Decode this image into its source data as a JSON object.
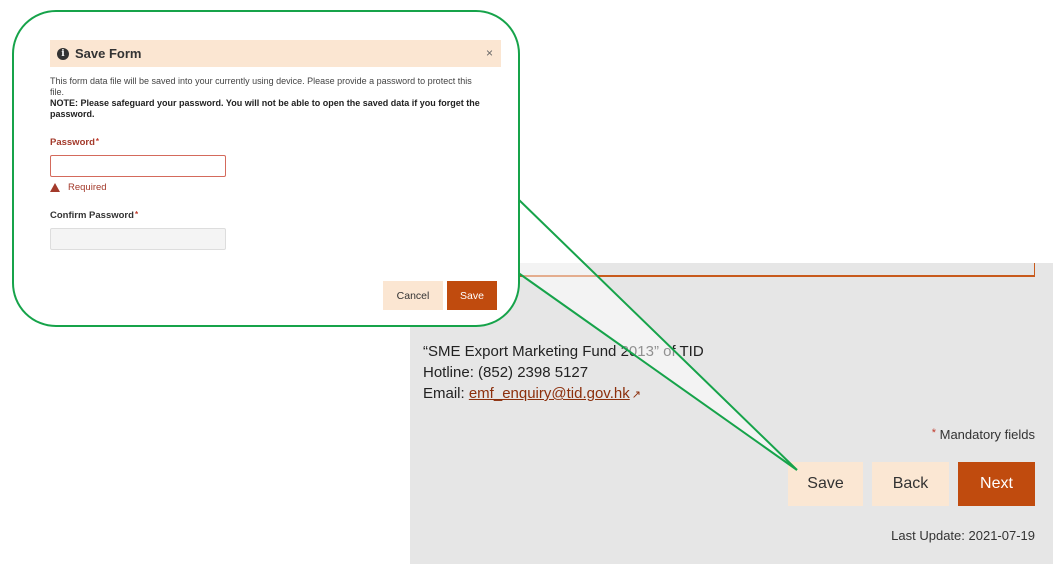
{
  "background_page": {
    "contact": {
      "line1": "“SME Export Marketing Fund 2013” of TID",
      "hotline": "Hotline: (852) 2398 5127",
      "email_prefix": "Email: ",
      "email": "emf_enquiry@tid.gov.hk",
      "external_icon": "external-link-icon"
    },
    "mandatory_star": "*",
    "mandatory_text": " Mandatory fields",
    "buttons": {
      "save": "Save",
      "back": "Back",
      "next": "Next"
    },
    "last_update": "Last Update: 2021-07-19"
  },
  "dialog": {
    "title": "Save Form",
    "title_icon": "info-icon",
    "close_label": "×",
    "description": "This form data file will be saved into your currently using device. Please provide a password to protect this file.",
    "note": "NOTE: Please safeguard your password. You will not be able to open the saved data if you forget the password.",
    "password_label": "Password",
    "password_value": "",
    "required_mark": "*",
    "required_error": "Required",
    "confirm_label": "Confirm Password",
    "confirm_value": "",
    "cancel_label": "Cancel",
    "save_label": "Save"
  },
  "colors": {
    "accent": "#c04b0e",
    "light_button": "#fbe7d3",
    "callout_border": "#16a34a",
    "error": "#a33a2b"
  }
}
